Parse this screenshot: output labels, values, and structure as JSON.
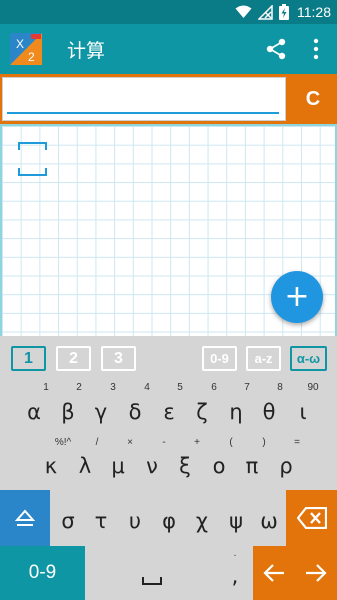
{
  "status_bar": {
    "time": "11:28",
    "battery_icon": "battery-charging-icon",
    "icons": [
      "wifi-icon",
      "signal-muted-icon",
      "battery-charging-icon"
    ]
  },
  "app_bar": {
    "title": "计算",
    "logo_text_top": "X",
    "logo_text_bottom": "2",
    "share_icon": "share-icon",
    "more_icon": "more-vert-icon"
  },
  "input": {
    "value": "",
    "clear_label": "C"
  },
  "fab": {
    "label": "+"
  },
  "keyboard_toolbar": {
    "pages": [
      "1",
      "2",
      "3"
    ],
    "active_page": "1",
    "modes": [
      "0-9",
      "a-z",
      "α-ω"
    ],
    "active_mode": "α-ω"
  },
  "keyboard": {
    "row1_sub": [
      "1",
      "2",
      "3",
      "4",
      "5",
      "6",
      "7",
      "8",
      "90"
    ],
    "row1_keys": [
      "α",
      "β",
      "γ",
      "δ",
      "ε",
      "ζ",
      "η",
      "θ",
      "ι"
    ],
    "row2_sub": [
      "%!^",
      "/",
      "×",
      "-",
      "+",
      "(",
      ")",
      "="
    ],
    "row2_keys": [
      "κ",
      "λ",
      "μ",
      "ν",
      "ξ",
      "ο",
      "π",
      "ρ"
    ],
    "row3_keys": [
      "σ",
      "τ",
      "υ",
      "φ",
      "χ",
      "ψ",
      "ω"
    ],
    "shift_icon": "shift-icon",
    "backspace_icon": "backspace-icon",
    "numbers_label": "0-9",
    "space_label": "␣",
    "comma_sub": ".",
    "comma_label": ",",
    "left_arrow_label": "←",
    "right_arrow_label": "→"
  },
  "colors": {
    "teal_dark": "#0a7c88",
    "teal": "#0e96a5",
    "orange": "#e3740b",
    "blue": "#2196e0",
    "keyboard_bg": "#d5d5d5"
  }
}
